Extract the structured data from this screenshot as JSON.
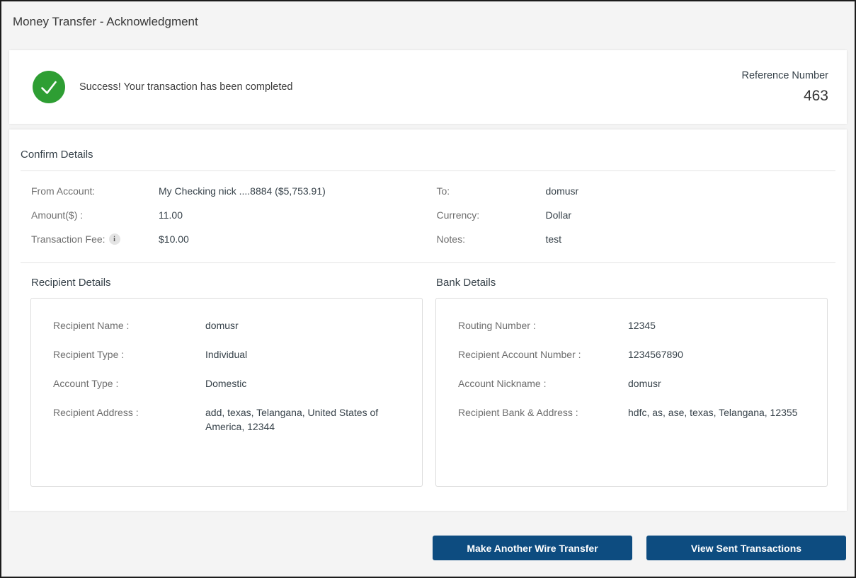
{
  "page": {
    "title": "Money Transfer - Acknowledgment"
  },
  "theme": {
    "success_green": "#2e9e33",
    "primary_navy": "#0d4c80"
  },
  "banner": {
    "icon": "check-circle",
    "message": "Success! Your transaction has been completed",
    "reference_label": "Reference Number",
    "reference_value": "463"
  },
  "confirm_details": {
    "heading": "Confirm Details",
    "info_icon": "i",
    "fields_left": [
      {
        "label": "From Account:",
        "value": "My Checking nick ....8884 ($5,753.91)"
      },
      {
        "label": "Amount($) :",
        "value": "11.00"
      },
      {
        "label": "Transaction Fee:",
        "value": "$10.00"
      }
    ],
    "fields_right": [
      {
        "label": "To:",
        "value": "domusr"
      },
      {
        "label": "Currency:",
        "value": "Dollar"
      },
      {
        "label": "Notes:",
        "value": "test"
      }
    ]
  },
  "recipient_details": {
    "heading": "Recipient Details",
    "fields": [
      {
        "label": "Recipient Name :",
        "value": "domusr"
      },
      {
        "label": "Recipient Type :",
        "value": "Individual"
      },
      {
        "label": "Account Type :",
        "value": "Domestic"
      },
      {
        "label": "Recipient Address :",
        "value": "add, texas, Telangana, United States of America, 12344"
      }
    ]
  },
  "bank_details": {
    "heading": "Bank Details",
    "fields": [
      {
        "label": "Routing Number :",
        "value": "12345"
      },
      {
        "label": "Recipient Account Number :",
        "value": "1234567890"
      },
      {
        "label": "Account Nickname :",
        "value": "domusr"
      },
      {
        "label": "Recipient Bank & Address :",
        "value": "hdfc, as, ase, texas, Telangana, 12355"
      }
    ]
  },
  "actions": {
    "make_another": "Make Another Wire Transfer",
    "view_sent": "View Sent Transactions"
  }
}
